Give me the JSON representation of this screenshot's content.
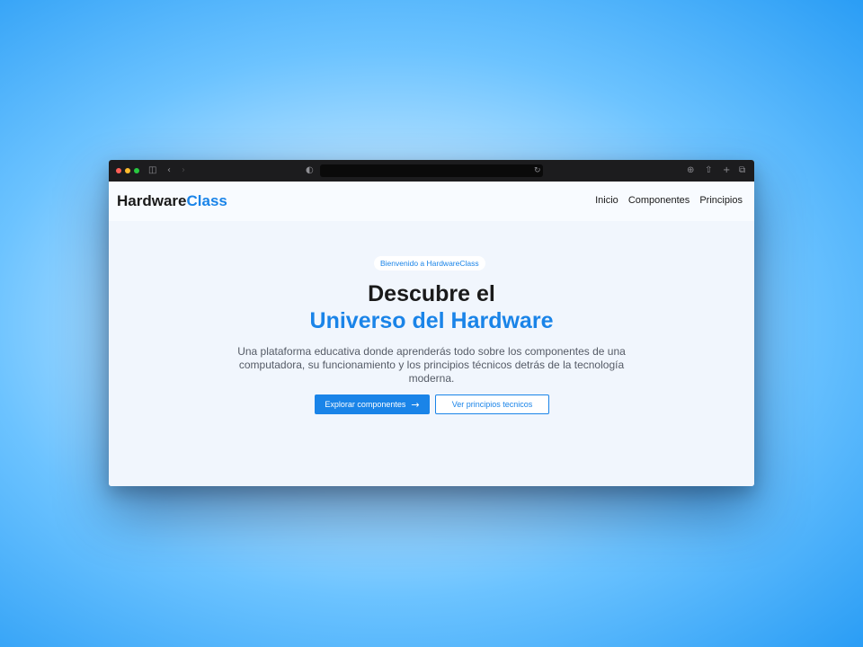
{
  "browser": {
    "traffic_lights": [
      "#ff5f57",
      "#febc2e",
      "#28c840"
    ],
    "icons": [
      "sidebar-icon",
      "back-icon",
      "forward-icon",
      "shield-icon",
      "reload-icon",
      "download-icon",
      "share-icon",
      "new-tab-icon",
      "tabs-icon"
    ]
  },
  "header": {
    "logo_part1": "Hardware",
    "logo_part2": "Class",
    "nav": [
      "Inicio",
      "Componentes",
      "Principios"
    ]
  },
  "hero": {
    "badge": "Bienvenido a HardwareClass",
    "title_line1": "Descubre el",
    "title_line2": "Universo del Hardware",
    "description": "Una plataforma educativa donde aprenderás todo sobre los componentes de una computadora, su funcionamiento y los principios técnicos detrás de la tecnología moderna.",
    "primary_button": "Explorar componentes",
    "secondary_button": "Ver principios tecnicos"
  },
  "colors": {
    "accent": "#1a84e8",
    "text": "#1a1a1a",
    "hero_bg": "#f1f6fd"
  }
}
